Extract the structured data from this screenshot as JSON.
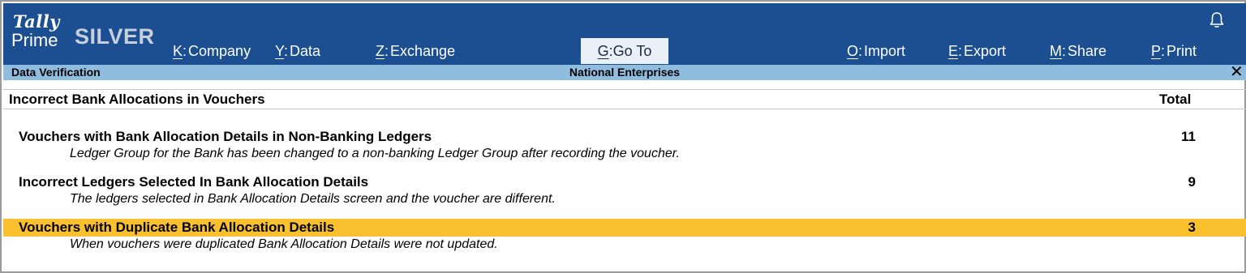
{
  "app": {
    "logo_top": "Tally",
    "logo_bottom": "Prime",
    "edition": "SILVER"
  },
  "menu": [
    {
      "key": "K",
      "label": "Company"
    },
    {
      "key": "Y",
      "label": "Data"
    },
    {
      "key": "Z",
      "label": "Exchange"
    },
    {
      "key": "G",
      "label": "Go To"
    },
    {
      "key": "O",
      "label": "Import"
    },
    {
      "key": "E",
      "label": "Export"
    },
    {
      "key": "M",
      "label": "Share"
    },
    {
      "key": "P",
      "label": "Print"
    }
  ],
  "icons": {
    "notification": "bell-icon",
    "close": "close-icon"
  },
  "titlebar": {
    "screen": "Data Verification",
    "company": "National Enterprises",
    "close_glyph": "✕"
  },
  "report": {
    "title": "Incorrect Bank Allocations in Vouchers",
    "column": "Total",
    "rows": [
      {
        "label": "Vouchers with Bank Allocation Details in Non-Banking Ledgers",
        "description": "Ledger Group for the Bank has been changed to a non-banking Ledger Group after recording the voucher.",
        "count": "11"
      },
      {
        "label": "Incorrect Ledgers Selected In Bank Allocation Details",
        "description": "The ledgers selected in Bank Allocation Details screen and the voucher are different.",
        "count": "9"
      },
      {
        "label": "Vouchers with Duplicate Bank Allocation Details",
        "description": "When vouchers were duplicated Bank Allocation Details were not updated.",
        "count": "3",
        "selected": true
      }
    ]
  },
  "colors": {
    "topbar": "#1c4f92",
    "titlebar": "#8fbde0",
    "highlight": "#fbc02d"
  }
}
